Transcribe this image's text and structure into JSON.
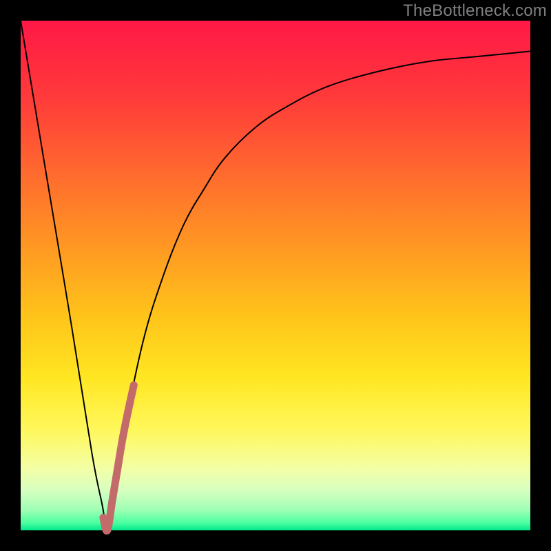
{
  "attribution": "TheBottleneck.com",
  "chart_data": {
    "type": "line",
    "title": "",
    "xlabel": "",
    "ylabel": "",
    "xlim": [
      0,
      100
    ],
    "ylim": [
      0,
      100
    ],
    "background": {
      "type": "vertical-gradient",
      "stops": [
        {
          "pos": 0.0,
          "color": "#ff1846"
        },
        {
          "pos": 0.15,
          "color": "#ff3a3a"
        },
        {
          "pos": 0.3,
          "color": "#ff6a2e"
        },
        {
          "pos": 0.45,
          "color": "#ff9a22"
        },
        {
          "pos": 0.58,
          "color": "#ffc41a"
        },
        {
          "pos": 0.7,
          "color": "#ffe622"
        },
        {
          "pos": 0.8,
          "color": "#fff75a"
        },
        {
          "pos": 0.88,
          "color": "#f3ffa6"
        },
        {
          "pos": 0.92,
          "color": "#d8ffc0"
        },
        {
          "pos": 0.96,
          "color": "#9fffb5"
        },
        {
          "pos": 0.985,
          "color": "#4cffa0"
        },
        {
          "pos": 1.0,
          "color": "#00e88c"
        }
      ]
    },
    "series": [
      {
        "name": "bottleneck-curve",
        "color": "#000000",
        "width": 2,
        "x": [
          0,
          5,
          10,
          14,
          16,
          17,
          18,
          20,
          24,
          28,
          32,
          36,
          40,
          46,
          52,
          60,
          70,
          80,
          90,
          100
        ],
        "values": [
          100,
          70,
          40,
          15,
          5,
          0,
          6,
          18,
          37,
          50,
          60,
          67,
          73,
          79,
          83,
          87,
          90,
          92,
          93,
          94
        ]
      },
      {
        "name": "highlight-segment",
        "color": "#c36a6a",
        "width": 11,
        "x": [
          16.2,
          17,
          18,
          19,
          20,
          21,
          22.2
        ],
        "values": [
          2.5,
          0,
          6,
          12,
          18,
          23,
          28.5
        ]
      }
    ]
  }
}
